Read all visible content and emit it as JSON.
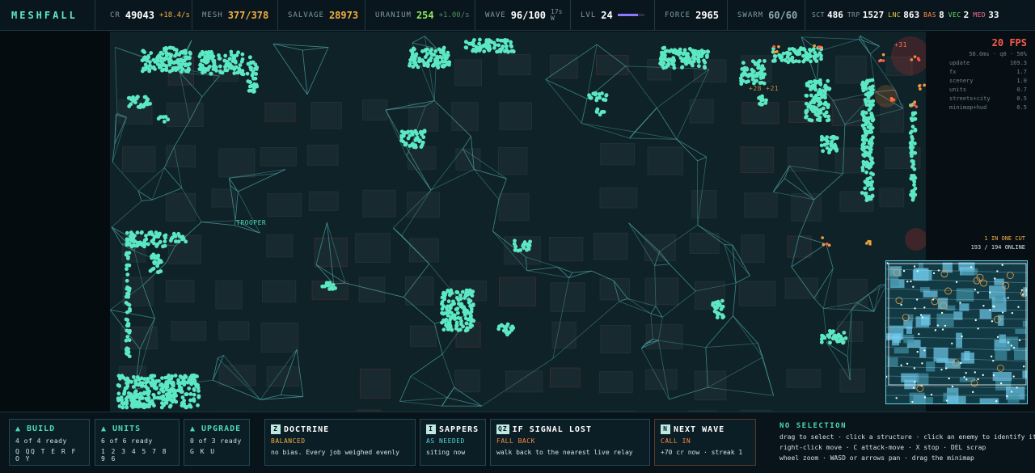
{
  "brand": "MESHFALL",
  "colors": {
    "accent": "#4fd8b5",
    "warn": "#ff5a4a",
    "gold": "#f0b042",
    "xp": "#8d79ff"
  },
  "topbar": {
    "cr": {
      "label": "CR",
      "value": "49043",
      "rate": "+18.4/s"
    },
    "mesh": {
      "label": "MESH",
      "value": "377/378"
    },
    "salvage": {
      "label": "SALVAGE",
      "value": "28973"
    },
    "uranium": {
      "label": "URANIUM",
      "value": "254",
      "rate": "+1.00/s"
    },
    "wave": {
      "label": "WAVE",
      "value": "96/100",
      "timer": "17s",
      "dir": "W"
    },
    "level": {
      "label": "LVL",
      "value": "24",
      "progress": 0.75
    },
    "force": {
      "label": "FORCE",
      "value": "2965"
    },
    "swarm": {
      "label": "SWARM",
      "value": "60/60"
    },
    "counts": [
      {
        "label": "SCT",
        "value": "486",
        "color": "#7f9aa0"
      },
      {
        "label": "TRP",
        "value": "1527",
        "color": "#7f9aa0"
      },
      {
        "label": "LNC",
        "value": "863",
        "color": "#e8c640"
      },
      {
        "label": "BAS",
        "value": "8",
        "color": "#ff8a40"
      },
      {
        "label": "VEC",
        "value": "2",
        "color": "#6adf5c"
      },
      {
        "label": "MED",
        "value": "33",
        "color": "#ff6b8a"
      }
    ]
  },
  "perf": {
    "fps": "20 FPS",
    "meta": "50.0ms · q0 · 50%",
    "rows": [
      {
        "k": "update",
        "v": "169.3"
      },
      {
        "k": "fx",
        "v": "1.7"
      },
      {
        "k": "scenery",
        "v": "1.0"
      },
      {
        "k": "units",
        "v": "0.7"
      },
      {
        "k": "streets+city",
        "v": "0.5"
      },
      {
        "k": "minimap+hud",
        "v": "0.5"
      }
    ]
  },
  "minimap": {
    "status": "1 IN ONE CUT",
    "online": "193 / 194 ONLINE"
  },
  "map_labels": {
    "unit_tag": "TROOPER",
    "damage_1": "+31",
    "damage_2": "+28 +21"
  },
  "bottom": {
    "build": {
      "title": "▲ BUILD",
      "sub": "4 of 4 ready",
      "keys": "Q QQ T E R F O Y"
    },
    "units": {
      "title": "▲ UNITS",
      "sub": "6 of 6 ready",
      "keys": "1 2 3 4 5 7 8 9 6"
    },
    "upgrade": {
      "title": "▲ UPGRADE",
      "sub": "0 of 3 ready",
      "keys": "G K U"
    },
    "doctrine": {
      "key": "Z",
      "title": "DOCTRINE",
      "state": "BALANCED",
      "desc": "no bias. Every job weighed evenly"
    },
    "sappers": {
      "key": "I",
      "title": "SAPPERS",
      "state": "AS NEEDED",
      "desc": "siting now"
    },
    "signal": {
      "key": "QZ",
      "title": "IF SIGNAL LOST",
      "state": "FALL BACK",
      "desc": "walk back to the nearest live relay"
    },
    "nextwave": {
      "key": "N",
      "title": "NEXT WAVE",
      "state": "CALL IN",
      "desc": "+70 cr now · streak 1"
    },
    "help": {
      "heading": "NO SELECTION",
      "lines": [
        "drag to select · click a structure · click an enemy to identify it",
        "right-click move · C attack-move · X stop · DEL scrap",
        "wheel zoom · WASD or arrows pan · drag the minimap"
      ]
    }
  }
}
